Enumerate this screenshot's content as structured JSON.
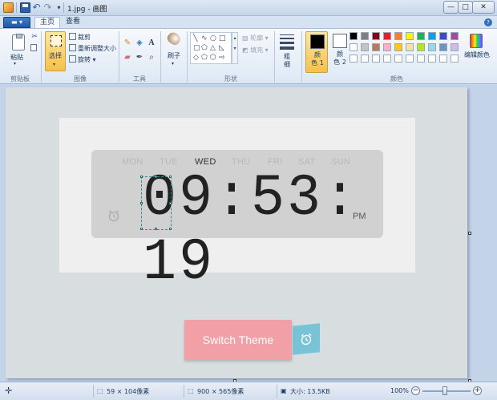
{
  "window": {
    "title": "1.jpg - 画图",
    "minimize": "—",
    "maximize": "□",
    "close": "✕"
  },
  "ribbon": {
    "tabs": {
      "home": "主页",
      "view": "查看"
    },
    "app_menu": "▬ ▾",
    "groups": {
      "clipboard": "剪贴板",
      "image": "图像",
      "tools": "工具",
      "shapes": "形状",
      "colors": "颜色"
    },
    "clipboard": {
      "paste": "粘贴",
      "cut_icon": "scissors-icon",
      "copy_icon": "copy-icon"
    },
    "image": {
      "select": "选择",
      "crop": "裁剪",
      "resize": "重新调整大小",
      "rotate": "旋转 ▾"
    },
    "tools": {
      "brush": "刷子"
    },
    "shapes": {
      "outline": "轮廓 ▾",
      "fill": "填充 ▾"
    },
    "size": {
      "label": "粗\n细"
    },
    "colors": {
      "color1": "颜\n色 1",
      "color2": "颜\n色 2",
      "edit": "编辑颜色",
      "color1_value": "#000000",
      "color2_value": "#ffffff",
      "palette": [
        "#000000",
        "#7f7f7f",
        "#880015",
        "#ed1c24",
        "#ff7f27",
        "#fff200",
        "#22b14c",
        "#00a2e8",
        "#3f48cc",
        "#a349a4",
        "#ffffff",
        "#c3c3c3",
        "#b97a57",
        "#ffaec9",
        "#ffc90e",
        "#efe4b0",
        "#b5e61d",
        "#99d9ea",
        "#7092be",
        "#c8bfe7"
      ]
    }
  },
  "canvas": {
    "clock": {
      "days": [
        "MON",
        "TUE",
        "WED",
        "THU",
        "FRI",
        "SAT",
        "SUN"
      ],
      "active_day": "WED",
      "time": "09:53: 19",
      "ampm": "PM"
    },
    "switch_button": "Switch Theme",
    "accent_pink": "#f0a0a6",
    "accent_blue": "#79c3d6"
  },
  "status": {
    "cursor_icon": "move-cross-icon",
    "selection": "59 × 104像素",
    "image_size": "900 × 565像素",
    "file_size": "大小: 13.5KB",
    "zoom": "100%"
  }
}
